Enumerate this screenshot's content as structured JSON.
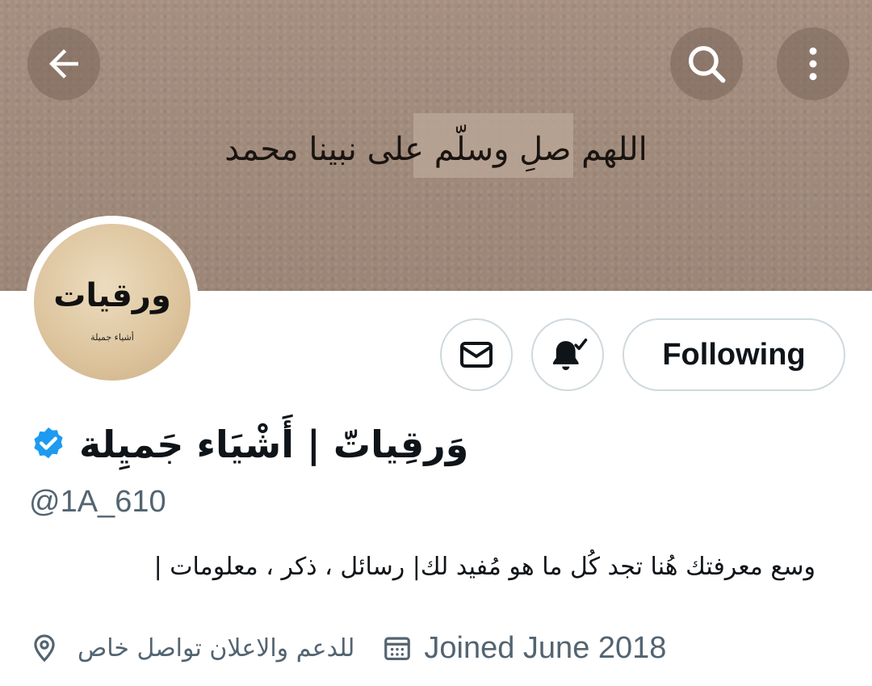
{
  "banner": {
    "text": "اللهم صلِ وسلّم على نبينا محمد"
  },
  "header": {
    "back_icon": "arrow-left-icon",
    "search_icon": "search-icon",
    "more_icon": "more-vertical-icon"
  },
  "avatar": {
    "title": "ورقيات",
    "subtitle": "أشياء جميلة"
  },
  "actions": {
    "message_icon": "envelope-icon",
    "notify_icon": "bell-check-icon",
    "follow_label": "Following"
  },
  "profile": {
    "display_name": "وَرقِياتّ | أَشْيَاء جَميِلة",
    "verified_icon": "verified-badge-icon",
    "handle": "@1A_610",
    "bio": "وسع معرفتك هُنا تجد كُل ما هو مُفيد لك| رسائل ، ذكر ، معلومات |",
    "location": "للدعم والاعلان تواصل خاص",
    "location_icon": "location-pin-icon",
    "joined": "Joined June 2018",
    "joined_icon": "calendar-icon"
  },
  "colors": {
    "verified_blue": "#1d9bf0",
    "secondary_text": "#536471",
    "border": "#cfd9de"
  }
}
